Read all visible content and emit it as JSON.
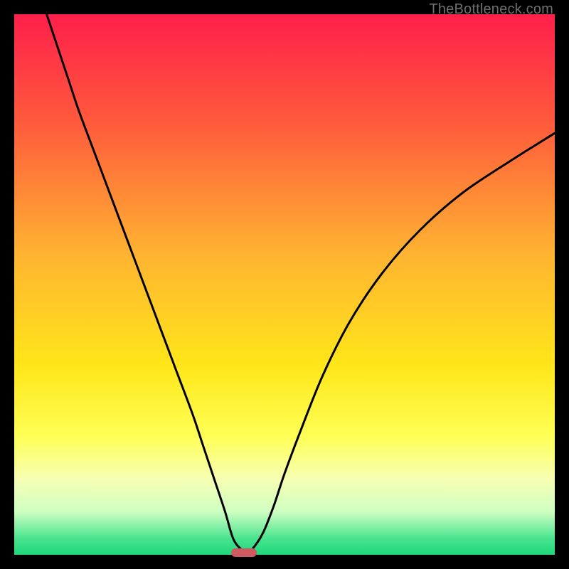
{
  "watermark": "TheBottleneck.com",
  "chart_data": {
    "type": "line",
    "title": "",
    "xlabel": "",
    "ylabel": "",
    "xlim": [
      0,
      100
    ],
    "ylim": [
      0,
      100
    ],
    "gradient_stops": [
      {
        "offset": 0,
        "color": "#ff1f4b"
      },
      {
        "offset": 20,
        "color": "#ff5a3c"
      },
      {
        "offset": 45,
        "color": "#ffb531"
      },
      {
        "offset": 65,
        "color": "#ffe619"
      },
      {
        "offset": 78,
        "color": "#ffff55"
      },
      {
        "offset": 86,
        "color": "#f6ffb3"
      },
      {
        "offset": 92,
        "color": "#cfffc2"
      },
      {
        "offset": 97,
        "color": "#49e48e"
      },
      {
        "offset": 100,
        "color": "#1fd77b"
      }
    ],
    "series": [
      {
        "name": "bottleneck-curve",
        "x": [
          6,
          8,
          10,
          12,
          15,
          18,
          21,
          24,
          27,
          30,
          33,
          35,
          37,
          39,
          40.5,
          42,
          43,
          44,
          46,
          48,
          50,
          53,
          57,
          62,
          68,
          75,
          83,
          92,
          100
        ],
        "y": [
          100,
          94,
          88,
          82,
          74,
          66,
          58,
          50,
          42,
          34,
          26,
          20,
          14,
          8,
          3,
          1,
          0.5,
          1,
          4,
          9,
          15,
          23,
          33,
          43,
          52,
          60,
          67,
          73,
          78
        ]
      }
    ],
    "marker": {
      "x": 42.5,
      "y": 0,
      "color": "#cf5b60"
    },
    "legend": []
  }
}
